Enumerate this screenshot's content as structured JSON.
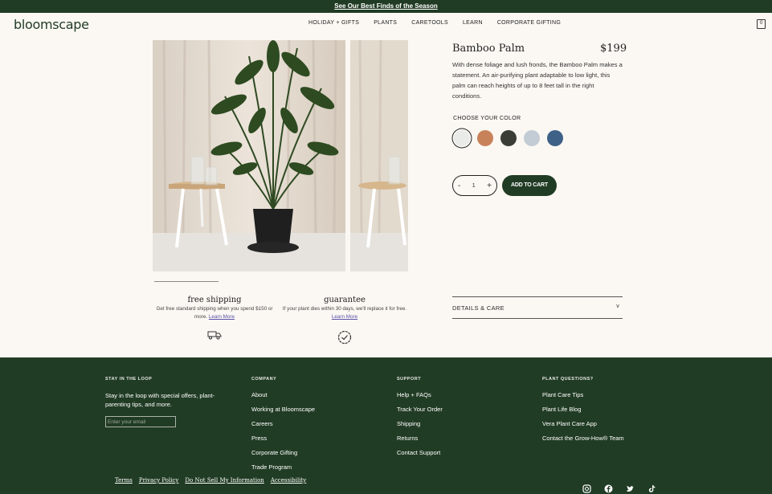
{
  "banner": {
    "text": "See Our Best Finds of the Season"
  },
  "header": {
    "logo": "bloomscape",
    "nav": [
      "HOLIDAY + GIFTS",
      "PLANTS",
      "CARETOOLS",
      "LEARN",
      "CORPORATE GIFTING"
    ],
    "cart_count": "0"
  },
  "product": {
    "name": "Bamboo Palm",
    "price": "$199",
    "description": "With dense foliage and lush fronds, the Bamboo Palm makes a statement. An air-purifying plant adaptable to low light, this palm can reach heights of up to 8 feet tall in the right conditions.",
    "color_label": "CHOOSE YOUR COLOR",
    "colors": [
      "#e8ebe8",
      "#c8825a",
      "#3a3d35",
      "#c3ccd4",
      "#3e6188"
    ],
    "selected_color": 0,
    "quantity": "1",
    "minus": "-",
    "plus": "+",
    "add_to_cart": "ADD TO CART",
    "details_label": "DETAILS & CARE",
    "details_chevron": "v"
  },
  "features": [
    {
      "title": "free shipping",
      "text": "Get free standard shipping when you spend $150 or more.",
      "link": "Learn More",
      "icon": "truck-icon"
    },
    {
      "title": "guarantee",
      "text": "If your plant dies within 30 days, we'll replace it for free.",
      "link": "Learn More",
      "icon": "check-badge-icon"
    }
  ],
  "footer": {
    "loop": {
      "heading": "STAY IN THE LOOP",
      "text": "Stay in the loop with special offers, plant-parenting tips, and more.",
      "email_placeholder": "Enter your email"
    },
    "company": {
      "heading": "COMPANY",
      "links": [
        "About",
        "Working at Bloomscape",
        "Careers",
        "Press",
        "Corporate Gifting",
        "Trade Program"
      ]
    },
    "support": {
      "heading": "SUPPORT",
      "links": [
        "Help + FAQs",
        "Track Your Order",
        "Shipping",
        "Returns",
        "Contact Support"
      ]
    },
    "questions": {
      "heading": "PLANT QUESTIONS?",
      "links": [
        "Plant Care Tips",
        "Plant Life Blog",
        "Vera Plant Care App",
        "Contact the Grow-How® Team"
      ]
    },
    "legal": [
      "Terms",
      "Privacy Policy",
      "Do Not Sell My Information",
      "Accessibility"
    ],
    "social": [
      "instagram-icon",
      "facebook-icon",
      "twitter-icon",
      "tiktok-icon"
    ]
  }
}
